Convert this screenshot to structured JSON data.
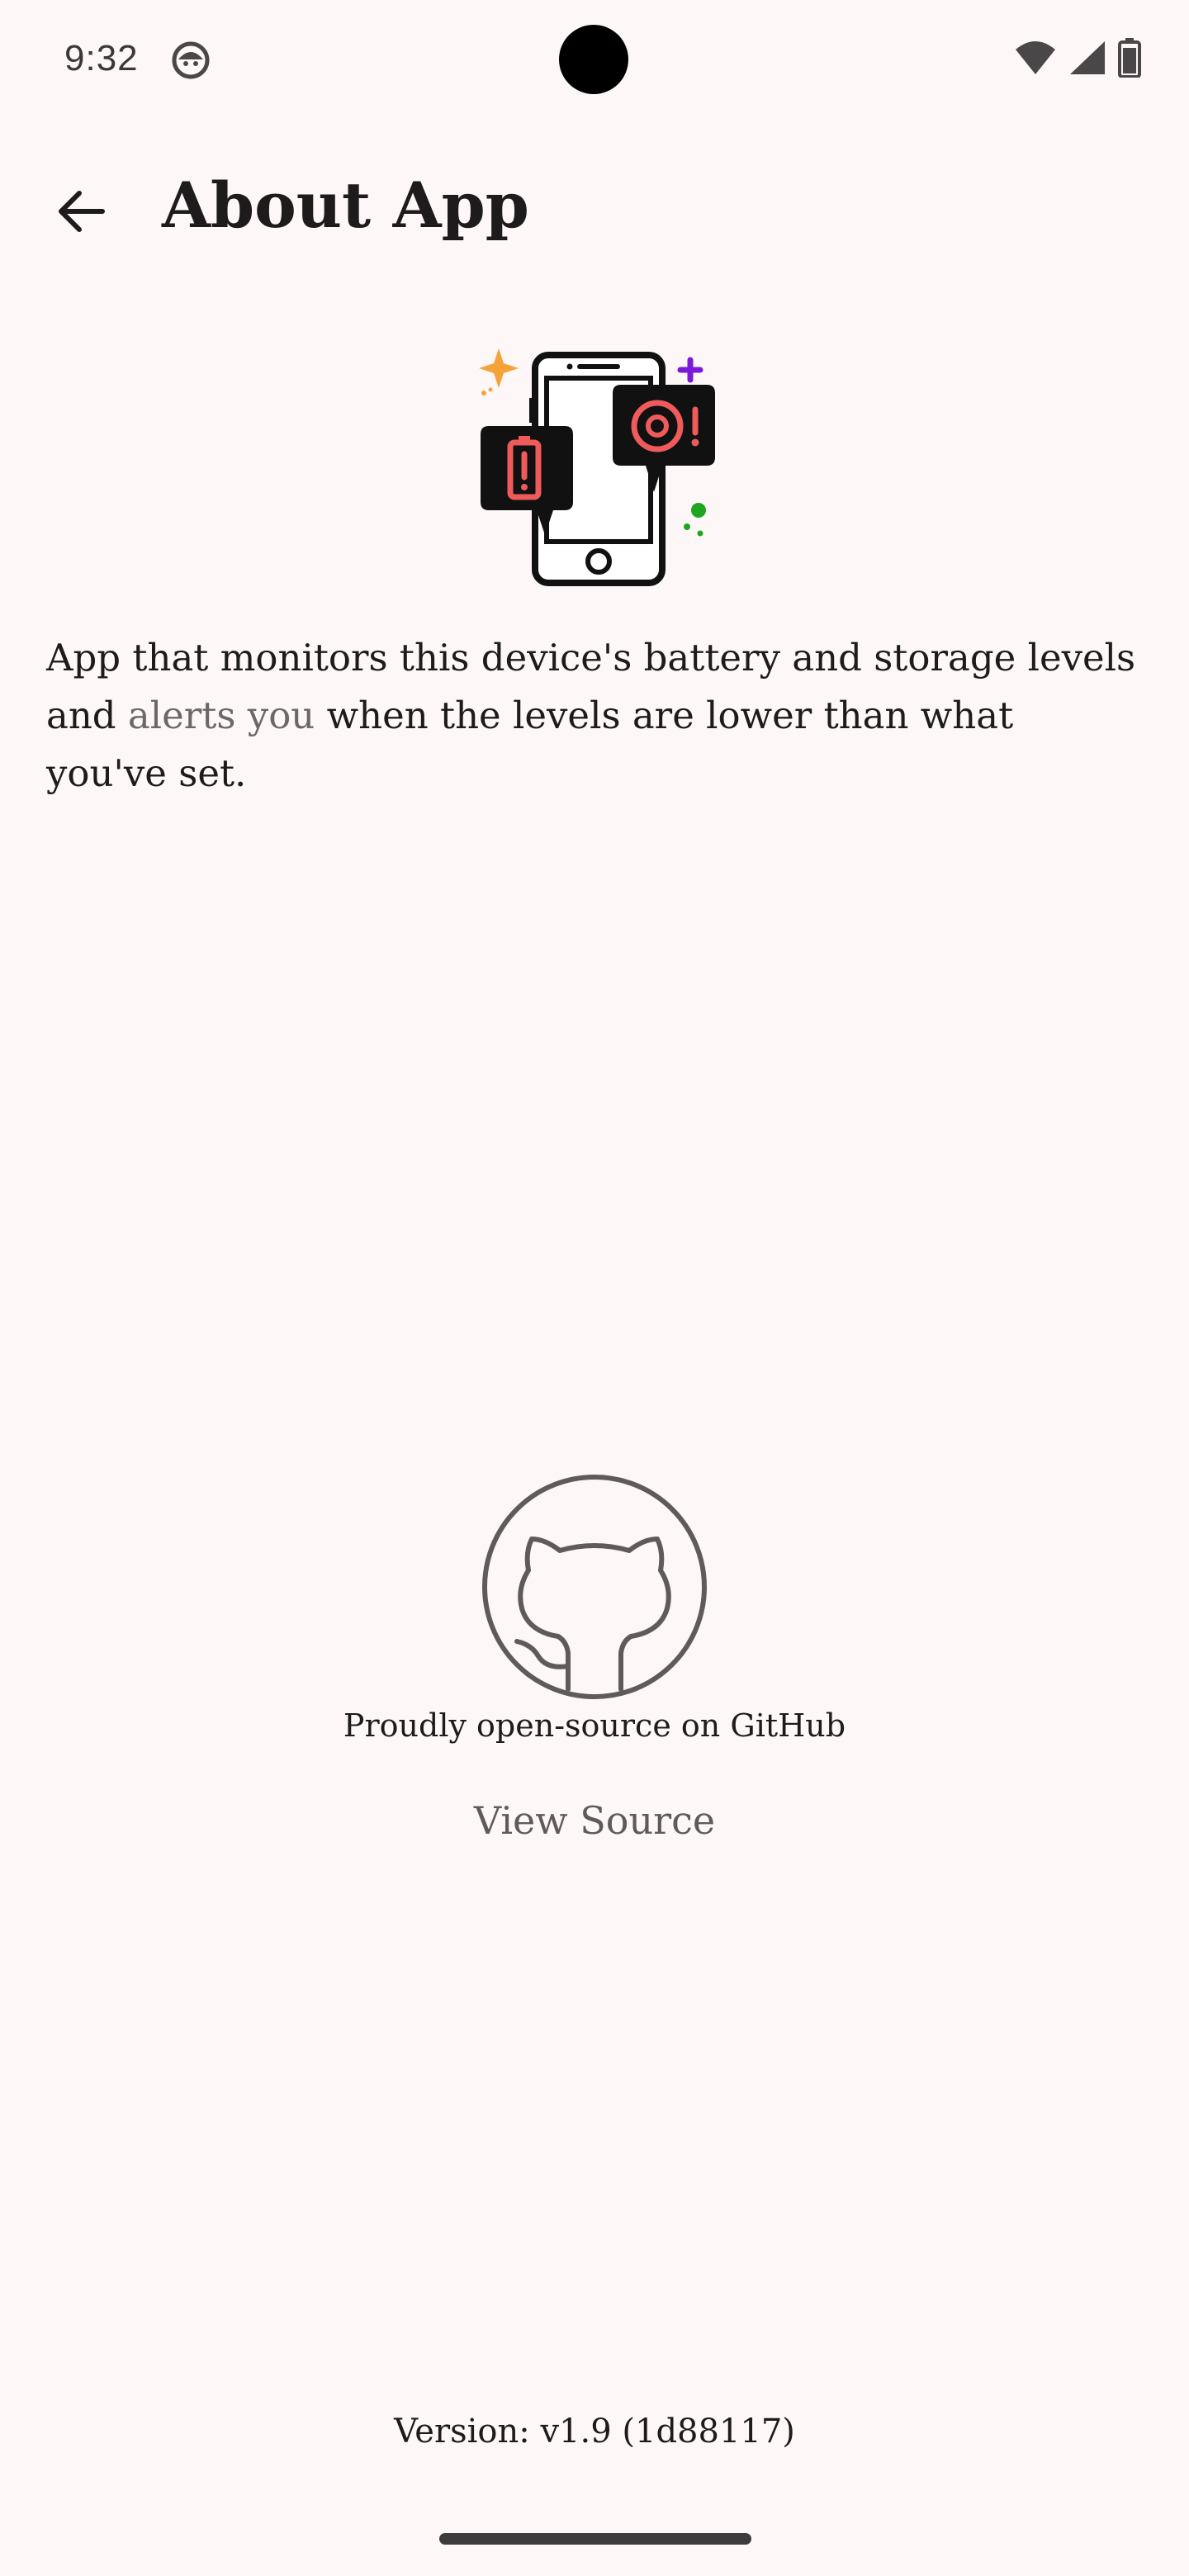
{
  "status_bar": {
    "time": "9:32",
    "icons": [
      "android-face-icon",
      "wifi-icon",
      "cell-signal-icon",
      "battery-icon"
    ]
  },
  "header": {
    "title": "About App",
    "back_icon": "arrow-left-icon"
  },
  "hero": {
    "icon": "phone-battery-storage-alert-illustration"
  },
  "description": {
    "before": "App that monitors this device's battery and storage levels and ",
    "highlight": "alerts you",
    "after": " when the levels are lower than what you've set."
  },
  "github": {
    "icon": "github-icon",
    "caption": "Proudly open-source on GitHub",
    "button_label": "View Source"
  },
  "footer": {
    "version": "Version: v1.9 (1d88117)"
  },
  "colors": {
    "background": "#fdf8f7",
    "text": "#1d1b1b",
    "muted": "#6e6668",
    "accent_red": "#ef5b5b",
    "accent_orange": "#f6a23a",
    "accent_purple": "#7a19d8",
    "accent_green": "#1fa51f"
  }
}
